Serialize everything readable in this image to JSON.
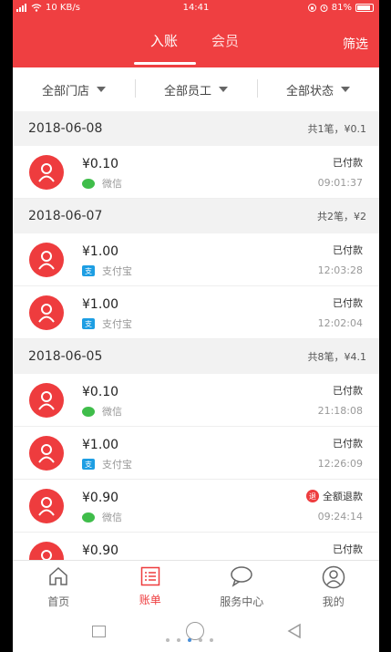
{
  "status_bar": {
    "left": "10 KB/s",
    "time": "14:41",
    "battery": "81%"
  },
  "header": {
    "tabs": [
      "入账",
      "会员"
    ],
    "filter_label": "筛选"
  },
  "filters": [
    "全部门店",
    "全部员工",
    "全部状态"
  ],
  "colors": {
    "primary": "#ef3f41",
    "wechat": "#3fbd4a",
    "alipay": "#1d9ee3"
  },
  "groups": [
    {
      "date": "2018-06-08",
      "summary": "共1笔，¥0.1",
      "rows": [
        {
          "amount": "¥0.10",
          "method": "微信",
          "method_icon": "wechat-icon",
          "status": "已付款",
          "time": "09:01:37"
        }
      ]
    },
    {
      "date": "2018-06-07",
      "summary": "共2笔，¥2",
      "rows": [
        {
          "amount": "¥1.00",
          "method": "支付宝",
          "method_icon": "alipay-icon",
          "status": "已付款",
          "time": "12:03:28"
        },
        {
          "amount": "¥1.00",
          "method": "支付宝",
          "method_icon": "alipay-icon",
          "status": "已付款",
          "time": "12:02:04"
        }
      ]
    },
    {
      "date": "2018-06-05",
      "summary": "共8笔，¥4.1",
      "rows": [
        {
          "amount": "¥0.10",
          "method": "微信",
          "method_icon": "wechat-icon",
          "status": "已付款",
          "time": "21:18:08"
        },
        {
          "amount": "¥1.00",
          "method": "支付宝",
          "method_icon": "alipay-icon",
          "status": "已付款",
          "time": "12:26:09"
        },
        {
          "amount": "¥0.90",
          "method": "微信",
          "method_icon": "wechat-icon",
          "status": "全额退款",
          "status_badge": "退",
          "time": "09:24:14"
        },
        {
          "amount": "¥0.90",
          "method": "",
          "method_icon": "",
          "status": "已付款",
          "time": ""
        }
      ]
    }
  ],
  "tabbar": [
    {
      "label": "首页",
      "icon": "home-icon"
    },
    {
      "label": "账单",
      "icon": "bill-list-icon",
      "active": true
    },
    {
      "label": "服务中心",
      "icon": "chat-bubble-icon"
    },
    {
      "label": "我的",
      "icon": "profile-icon"
    }
  ]
}
